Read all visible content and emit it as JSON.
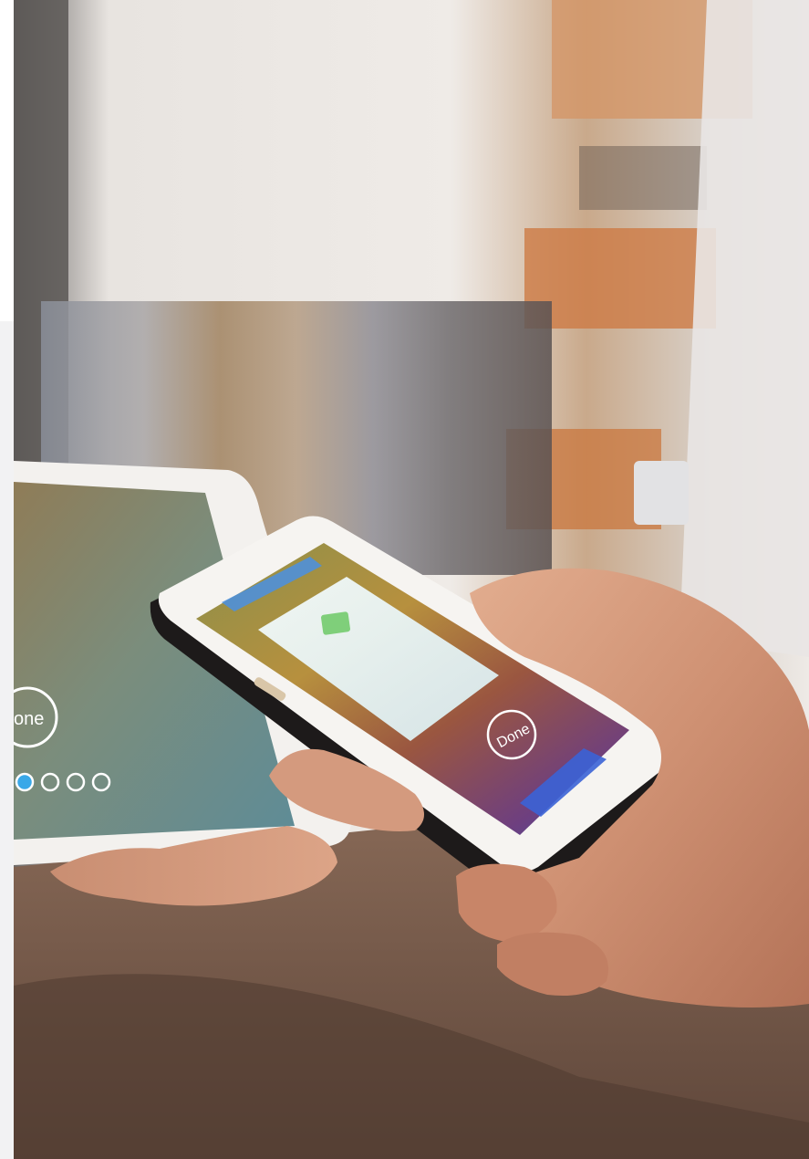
{
  "photo": {
    "description_alt": "",
    "tablet_screen": {
      "done_label": "one",
      "page_dots": 4,
      "active_dot": 1
    },
    "phone_screen": {
      "done_label": "Done"
    }
  },
  "colors": {
    "left_band": "#f2f2f3",
    "tablet_frame": "#f3f1ee",
    "phone_frame": "#f6f4f1",
    "dot_active": "#39a8e8",
    "card": "#e8f3f6",
    "card_chip": "#7fcf7a",
    "skin": "#d39a7c",
    "counter": "#6b5040"
  }
}
